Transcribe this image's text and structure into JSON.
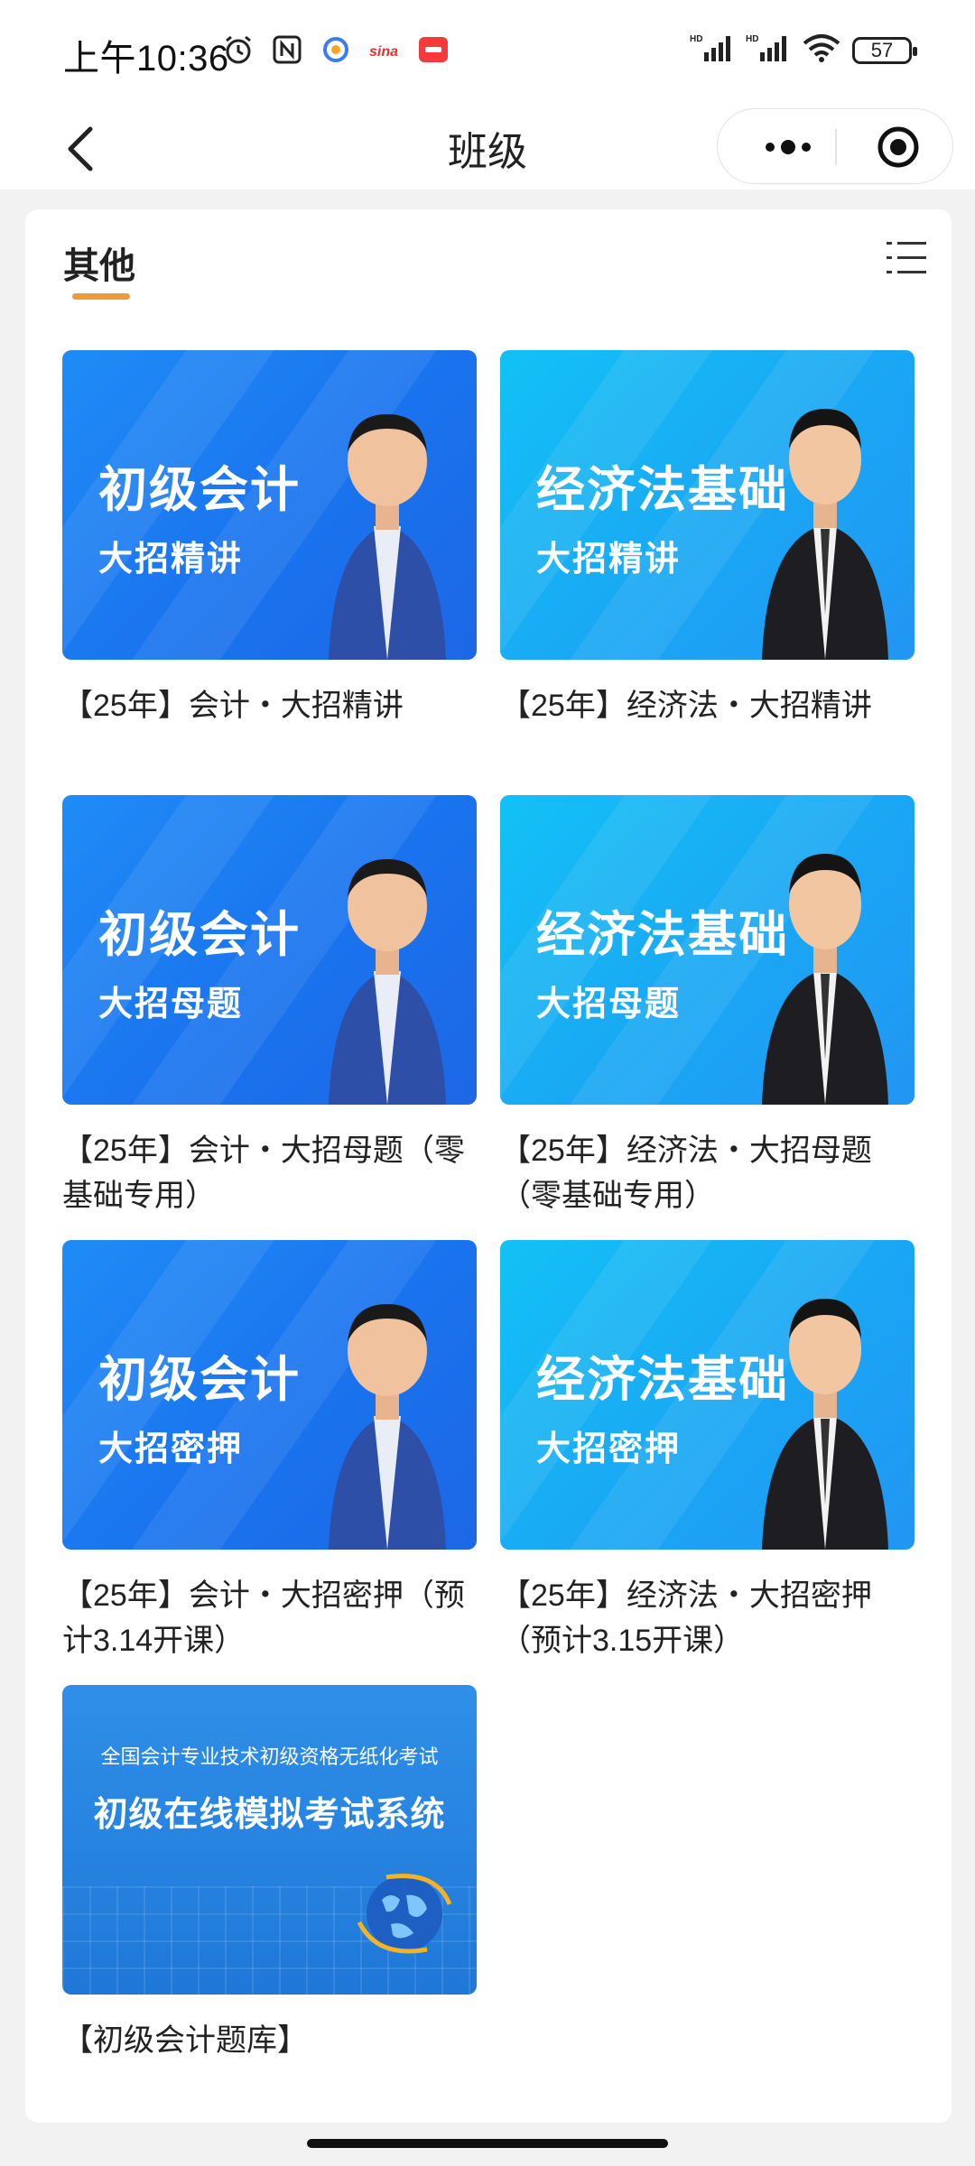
{
  "status_bar": {
    "time": "上午10:36",
    "battery": "57",
    "signal_label": "HD"
  },
  "nav": {
    "title": "班级"
  },
  "section": {
    "title": "其他",
    "accent_color": "#f39a38"
  },
  "courses": [
    {
      "thumb_line1": "初级会计",
      "thumb_line2": "大招精讲",
      "caption": "【25年】会计・大招精讲",
      "style": "blue"
    },
    {
      "thumb_line1": "经济法基础",
      "thumb_line2": "大招精讲",
      "caption": "【25年】经济法・大招精讲",
      "style": "cyan"
    },
    {
      "thumb_line1": "初级会计",
      "thumb_line2": "大招母题",
      "caption": "【25年】会计・大招母题（零基础专用）",
      "style": "blue"
    },
    {
      "thumb_line1": "经济法基础",
      "thumb_line2": "大招母题",
      "caption": "【25年】经济法・大招母题（零基础专用）",
      "style": "cyan"
    },
    {
      "thumb_line1": "初级会计",
      "thumb_line2": "大招密押",
      "caption": "【25年】会计・大招密押（预计3.14开课）",
      "style": "blue"
    },
    {
      "thumb_line1": "经济法基础",
      "thumb_line2": "大招密押",
      "caption": "【25年】经济法・大招密押（预计3.15开课）",
      "style": "cyan"
    }
  ],
  "exam_system": {
    "top_line": "全国会计专业技术初级资格无纸化考试",
    "main_line": "初级在线模拟考试系统",
    "caption": "【初级会计题库】"
  }
}
